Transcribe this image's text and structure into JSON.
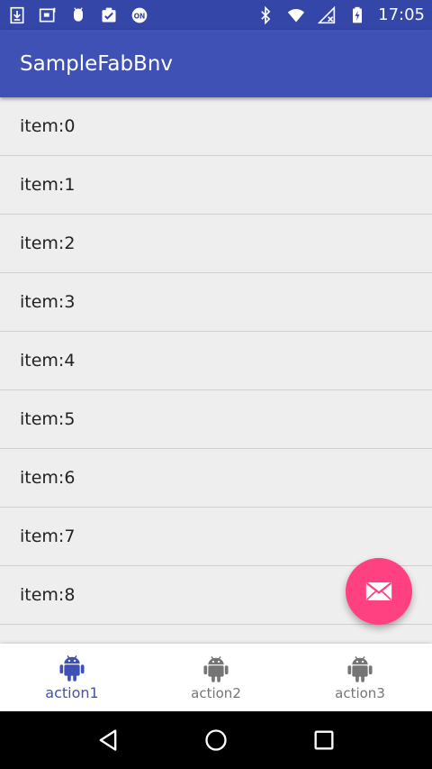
{
  "status_bar": {
    "time": "17:05",
    "left_icons": [
      "download-icon",
      "photo-icon",
      "android-icon",
      "clipboard-check-icon",
      "on-badge-icon"
    ],
    "on_badge_text": "ON",
    "right_icons": [
      "bluetooth-icon",
      "wifi-icon",
      "signal-off-icon",
      "battery-charging-icon"
    ]
  },
  "app_bar": {
    "title": "SampleFabBnv"
  },
  "list": {
    "items": [
      "item:0",
      "item:1",
      "item:2",
      "item:3",
      "item:4",
      "item:5",
      "item:6",
      "item:7",
      "item:8"
    ]
  },
  "fab": {
    "icon": "mail-icon"
  },
  "bottom_nav": {
    "items": [
      {
        "label": "action1",
        "icon": "android-icon",
        "active": true
      },
      {
        "label": "action2",
        "icon": "android-icon",
        "active": false
      },
      {
        "label": "action3",
        "icon": "android-icon",
        "active": false
      }
    ]
  },
  "colors": {
    "primary": "#3f51b5",
    "primary_dark": "#3446a8",
    "accent": "#ff4081",
    "inactive": "#757575"
  }
}
